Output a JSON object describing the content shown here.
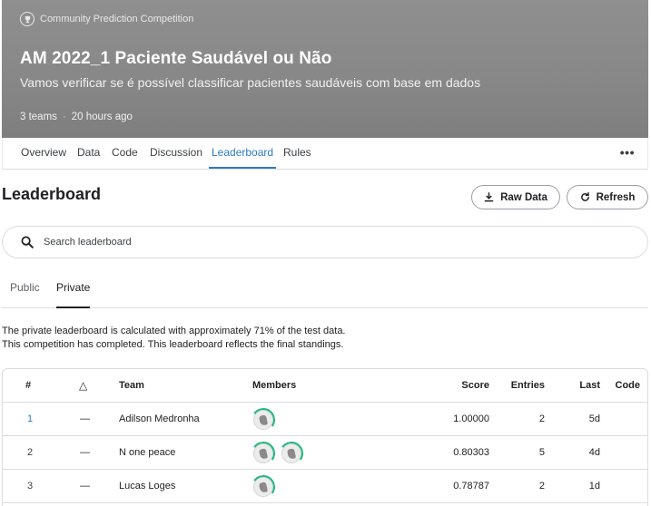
{
  "hero": {
    "badge": "Community Prediction Competition",
    "title": "AM 2022_1 Paciente Saudável ou Não",
    "subtitle": "Vamos verificar se é possível classificar pacientes saudáveis com base em dados",
    "teams": "3 teams",
    "separator": "·",
    "time": "20 hours ago"
  },
  "tabs": [
    "Overview",
    "Data",
    "Code",
    "Discussion",
    "Leaderboard",
    "Rules"
  ],
  "more": "•••",
  "leaderboard": {
    "title": "Leaderboard",
    "raw_data_label": "Raw Data",
    "refresh_label": "Refresh"
  },
  "search": {
    "placeholder": "Search leaderboard"
  },
  "subtabs": {
    "public": "Public",
    "private": "Private"
  },
  "note": {
    "line1": "The private leaderboard is calculated with approximately 71% of the test data.",
    "line2": "This competition has completed. This leaderboard reflects the final standings."
  },
  "table": {
    "headers": {
      "rank": "#",
      "delta": "△",
      "team": "Team",
      "members": "Members",
      "score": "Score",
      "entries": "Entries",
      "last": "Last",
      "code": "Code"
    },
    "rows": [
      {
        "rank": "1",
        "delta": "—",
        "team": "Adilson Medronha",
        "members": 1,
        "score": "1.00000",
        "entries": "2",
        "last": "5d"
      },
      {
        "rank": "2",
        "delta": "—",
        "team": "N one peace",
        "members": 2,
        "score": "0.80303",
        "entries": "5",
        "last": "4d"
      },
      {
        "rank": "3",
        "delta": "—",
        "team": "Lucas Loges",
        "members": 1,
        "score": "0.78787",
        "entries": "2",
        "last": "1d"
      }
    ]
  },
  "colors": {
    "accent": "#2e7bc4",
    "avatar_ring": "#1fb87d",
    "hero_bg": "#8a8a8a"
  }
}
